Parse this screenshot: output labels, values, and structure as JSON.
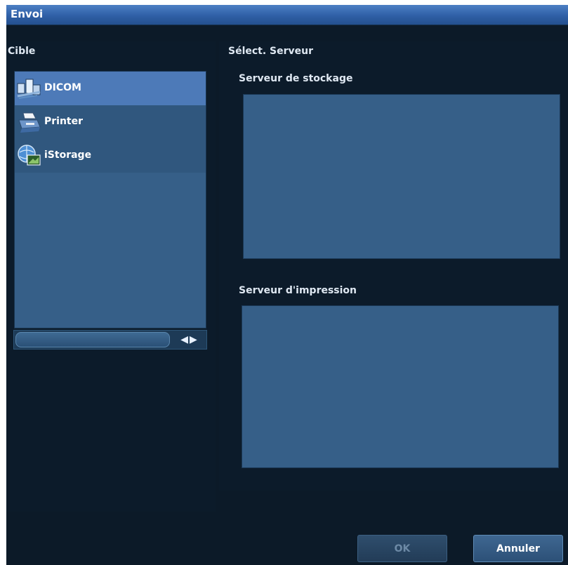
{
  "window": {
    "title": "Envoi"
  },
  "target": {
    "label": "Cible",
    "items": [
      {
        "label": "DICOM",
        "icon": "dicom-network-icon",
        "selected": true
      },
      {
        "label": "Printer",
        "icon": "printer-icon",
        "selected": false
      },
      {
        "label": "iStorage",
        "icon": "istorage-globe-icon",
        "selected": false
      }
    ]
  },
  "server_select": {
    "label": "Sélect. Serveur",
    "storage_label": "Serveur de stockage",
    "print_label": "Serveur d'impression"
  },
  "buttons": {
    "ok_label": "OK",
    "ok_enabled": false,
    "cancel_label": "Annuler"
  },
  "colors": {
    "background": "#0c1a28",
    "titlebar": "#2f5fa6",
    "list_selected": "#4d7ab8",
    "panel_fill": "#365f88"
  }
}
